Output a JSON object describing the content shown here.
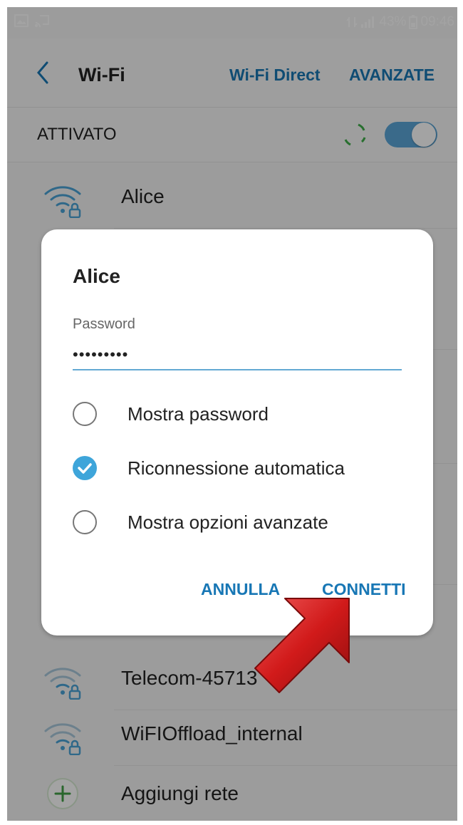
{
  "status_bar": {
    "right_text": "43%",
    "time": "09:46"
  },
  "header": {
    "title": "Wi-Fi",
    "wifi_direct": "Wi-Fi Direct",
    "advanced": "AVANZATE"
  },
  "toggle_row": {
    "label": "ATTIVATO",
    "enabled": true
  },
  "networks_top": [
    {
      "name": "Alice"
    }
  ],
  "dialog": {
    "title": "Alice",
    "password_label": "Password",
    "password_value": "•••••••••",
    "options": [
      {
        "label": "Mostra password",
        "checked": false
      },
      {
        "label": "Riconnessione automatica",
        "checked": true
      },
      {
        "label": "Mostra opzioni avanzate",
        "checked": false
      }
    ],
    "cancel": "ANNULLA",
    "connect": "CONNETTI"
  },
  "networks_bottom": [
    {
      "name": "Telecom-45713"
    },
    {
      "name": "WiFIOffload_internal"
    }
  ],
  "add_network": {
    "label": "Aggiungi rete"
  },
  "colors": {
    "accent": "#1877b5",
    "switch": "#5ba6d8",
    "check": "#3ea5da",
    "arrow": "#d11a1a"
  }
}
